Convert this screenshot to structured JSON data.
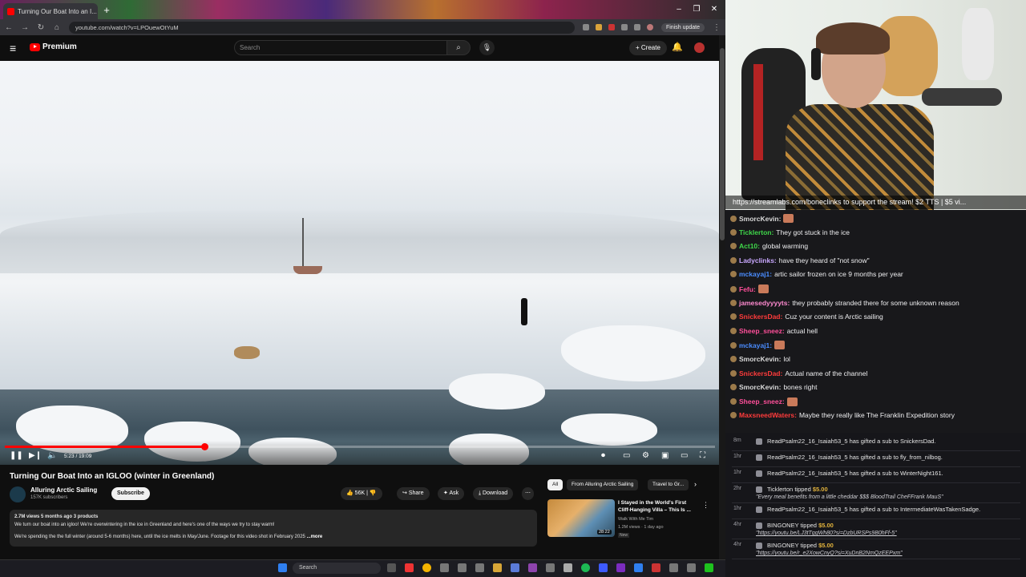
{
  "browser": {
    "tab_title": "Turning Our Boat Into an I...",
    "url": "youtube.com/watch?v=LPOuewOtYuM",
    "finish_update": "Finish update"
  },
  "youtube": {
    "premium_label": "Premium",
    "search_placeholder": "Search",
    "create_label": "+ Create"
  },
  "player": {
    "time": "5:23 / 19:09",
    "progress_fraction": 0.281
  },
  "video": {
    "title": "Turning Our Boat Into an IGLOO (winter in Greenland)",
    "channel": "Alluring Arctic Sailing",
    "subscribers": "157K subscribers",
    "subscribe_label": "Subscribe",
    "likes": "56K",
    "share_label": "Share",
    "ask_label": "Ask",
    "download_label": "Download",
    "desc_meta": "2.7M views  5 months ago  3 products",
    "desc_line1": "We turn our boat into an igloo! We're overwintering in the ice in Greenland and here's one of the ways we try to stay warm!",
    "desc_line2": "We're spending the the full winter (around 5-6 months) here, until the ice melts in May/June. Footage for this video shot in February 2025",
    "more_label": "...more"
  },
  "recommend": {
    "chips": [
      "All",
      "From Alluring Arctic Sailing",
      "Travel to Gr..."
    ],
    "title": "I Stayed in the World's First Cliff-Hanging Villa – This Is ...",
    "channel": "Walk With Me Tim",
    "meta": "1.2M views · 1 day ago",
    "badge": "New",
    "duration": "28:22"
  },
  "taskbar": {
    "search_label": "Search"
  },
  "stream": {
    "banner": "https://streamlabs.com/boneclinks to support the stream! $2 TTS | $5 vi..."
  },
  "chat": [
    {
      "user": "SmorcKevin:",
      "color": "#d9d9d9",
      "text": ""
    },
    {
      "user": "Ticklerton:",
      "color": "#3fd84a",
      "text": "They got stuck in the ice"
    },
    {
      "user": "Act10:",
      "color": "#3fd84a",
      "text": "global warming"
    },
    {
      "user": "Ladyclinks:",
      "color": "#c9a8ff",
      "text": "have they heard of \"not snow\""
    },
    {
      "user": "mckayaj1:",
      "color": "#4a8cff",
      "text": "artic sailor frozen on ice 9 months per year"
    },
    {
      "user": "Fefu:",
      "color": "#ff4f9a",
      "text": ""
    },
    {
      "user": "jamesedyyyyts:",
      "color": "#ff8ad0",
      "text": "they probably stranded there for some unknown reason"
    },
    {
      "user": "SnickersDad:",
      "color": "#ff3b3b",
      "text": "Cuz your content is Arctic sailing"
    },
    {
      "user": "Sheep_sneez:",
      "color": "#ff4f9a",
      "text": "actual hell"
    },
    {
      "user": "mckayaj1:",
      "color": "#4a8cff",
      "text": ""
    },
    {
      "user": "SmorcKevin:",
      "color": "#d9d9d9",
      "text": "lol"
    },
    {
      "user": "SnickersDad:",
      "color": "#ff3b3b",
      "text": "Actual name of the channel"
    },
    {
      "user": "SmorcKevin:",
      "color": "#d9d9d9",
      "text": "bones right"
    },
    {
      "user": "Sheep_sneez:",
      "color": "#ff4f9a",
      "text": ""
    },
    {
      "user": "MaxsneedWaters:",
      "color": "#ff3b3b",
      "text": "Maybe they really like The Franklin Expedition story"
    }
  ],
  "events": [
    {
      "time": "8m",
      "text": "ReadPsalm22_16_Isaiah53_5 has gifted a sub to SnickersDad."
    },
    {
      "time": "1hr",
      "text": "ReadPsalm22_16_Isaiah53_5 has gifted a sub to fly_from_nilbog."
    },
    {
      "time": "1hr",
      "text": "ReadPsalm22_16_Isaiah53_5 has gifted a sub to WinterNight161."
    },
    {
      "time": "2hr",
      "text": "Ticklerton tipped",
      "amount": "$5.00",
      "sub": "\"Every meal benefits from a little cheddar $$$ BloodTrail CheFFrank MauS\""
    },
    {
      "time": "1hr",
      "text": "ReadPsalm22_16_Isaiah53_5 has gifted a sub to IntermediateWasTakenSadge."
    },
    {
      "time": "4hr",
      "text": "BINGONEY tipped",
      "amount": "$5.00",
      "sub": "\"https://youtu.be/LJ3tTggWh80?si=DzbURSPs9B0hFf-5\""
    },
    {
      "time": "4hr",
      "text": "BINGONEY tipped",
      "amount": "$5.00",
      "sub": "\"https://youtu.be/r_e2XowCnyQ?si=XuDnB2NmQzEEPxm\""
    }
  ]
}
